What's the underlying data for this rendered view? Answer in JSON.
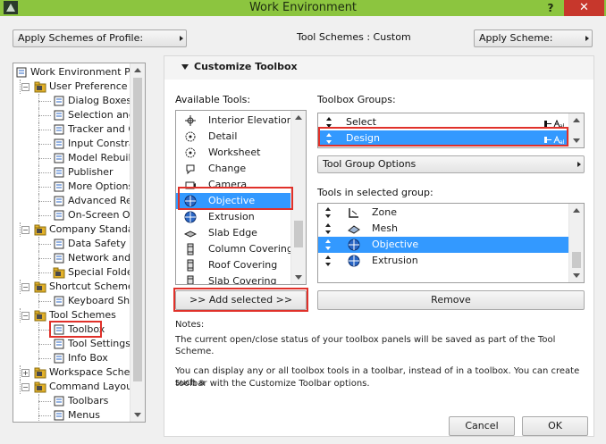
{
  "window": {
    "title": "Work Environment",
    "help_glyph": "?",
    "close_glyph": "✕"
  },
  "topbar": {
    "apply_schemes_label": "Apply Schemes of Profile:",
    "tool_schemes_text": "Tool Schemes : Custom",
    "apply_scheme_label": "Apply Scheme:"
  },
  "tree": {
    "items": [
      {
        "label": "Work Environment Pro",
        "level": 0,
        "icon": "work-environment-icon"
      },
      {
        "label": "User Preference S",
        "level": 1,
        "icon": "user-preference-folder-icon",
        "expander": "−"
      },
      {
        "label": "Dialog Boxes a",
        "level": 2,
        "icon": "dialog-boxes-icon"
      },
      {
        "label": "Selection and E",
        "level": 2,
        "icon": "selection-icon"
      },
      {
        "label": "Tracker and Co",
        "level": 2,
        "icon": "tracker-icon"
      },
      {
        "label": "Input Constrai",
        "level": 2,
        "icon": "input-constraints-icon"
      },
      {
        "label": "Model Rebuild",
        "level": 2,
        "icon": "model-rebuild-icon"
      },
      {
        "label": "Publisher",
        "level": 2,
        "icon": "publisher-icon"
      },
      {
        "label": "More Options",
        "level": 2,
        "icon": "more-options-icon"
      },
      {
        "label": "Advanced Red",
        "level": 2,
        "icon": "advanced-redraw-icon"
      },
      {
        "label": "On-Screen Opt",
        "level": 2,
        "icon": "on-screen-options-icon"
      },
      {
        "label": "Company Standard",
        "level": 1,
        "icon": "company-standards-folder-icon",
        "expander": "−"
      },
      {
        "label": "Data Safety &",
        "level": 2,
        "icon": "data-safety-icon"
      },
      {
        "label": "Network and L",
        "level": 2,
        "icon": "network-icon"
      },
      {
        "label": "Special Folders",
        "level": 2,
        "icon": "special-folders-icon"
      },
      {
        "label": "Shortcut Schemes",
        "level": 1,
        "icon": "shortcut-schemes-folder-icon",
        "expander": "−"
      },
      {
        "label": "Keyboard Shor",
        "level": 2,
        "icon": "keyboard-shortcuts-icon"
      },
      {
        "label": "Tool Schemes",
        "level": 1,
        "icon": "tool-schemes-folder-icon",
        "expander": "−"
      },
      {
        "label": "Toolbox",
        "level": 2,
        "icon": "toolbox-icon"
      },
      {
        "label": "Tool Settings D",
        "level": 2,
        "icon": "tool-settings-icon"
      },
      {
        "label": "Info Box",
        "level": 2,
        "icon": "info-box-icon"
      },
      {
        "label": "Workspace Scheme",
        "level": 1,
        "icon": "workspace-scheme-folder-icon",
        "expander": "+"
      },
      {
        "label": "Command Layout S",
        "level": 1,
        "icon": "command-layout-folder-icon",
        "expander": "−"
      },
      {
        "label": "Toolbars",
        "level": 2,
        "icon": "toolbars-icon"
      },
      {
        "label": "Menus",
        "level": 2,
        "icon": "menus-icon"
      }
    ]
  },
  "section": {
    "title": "Customize Toolbox"
  },
  "available_tools": {
    "label": "Available Tools:",
    "items": [
      {
        "label": "Interior Elevation",
        "icon": "interior-elevation-icon"
      },
      {
        "label": "Detail",
        "icon": "detail-icon"
      },
      {
        "label": "Worksheet",
        "icon": "worksheet-icon"
      },
      {
        "label": "Change",
        "icon": "change-icon"
      },
      {
        "label": "Camera",
        "icon": "camera-icon"
      },
      {
        "label": "Objective",
        "icon": "objective-icon"
      },
      {
        "label": "Extrusion",
        "icon": "extrusion-icon"
      },
      {
        "label": "Slab Edge",
        "icon": "slab-edge-icon"
      },
      {
        "label": "Column Covering",
        "icon": "column-covering-icon"
      },
      {
        "label": "Roof Covering",
        "icon": "roof-covering-icon"
      },
      {
        "label": "Slab Covering",
        "icon": "slab-covering-icon"
      }
    ],
    "selected": "Objective",
    "add_button": ">> Add selected >>"
  },
  "toolbox_groups": {
    "label": "Toolbox Groups:",
    "items": [
      {
        "label": "Select"
      },
      {
        "label": "Design"
      }
    ],
    "selected": "Design",
    "options_button": "Tool Group Options"
  },
  "tools_in_group": {
    "label": "Tools in selected group:",
    "items": [
      {
        "label": "Zone",
        "icon": "zone-icon"
      },
      {
        "label": "Mesh",
        "icon": "mesh-icon"
      },
      {
        "label": "Objective",
        "icon": "objective-icon"
      },
      {
        "label": "Extrusion",
        "icon": "extrusion-icon"
      }
    ],
    "selected": "Objective",
    "remove_button": "Remove"
  },
  "notes": {
    "heading": "Notes:",
    "line1": "The current open/close status of your toolbox panels will be saved as part of the Tool Scheme.",
    "line2": "You can display any or all toolbox tools in a toolbar, instead of in a toolbox. You can create such a",
    "line3": "toolbar with the Customize Toolbar options."
  },
  "footer": {
    "cancel": "Cancel",
    "ok": "OK"
  },
  "colors": {
    "titlebar": "#8cc53f",
    "selection": "#3399ff",
    "highlight_box": "#e0312a",
    "close_button": "#c7372c"
  }
}
